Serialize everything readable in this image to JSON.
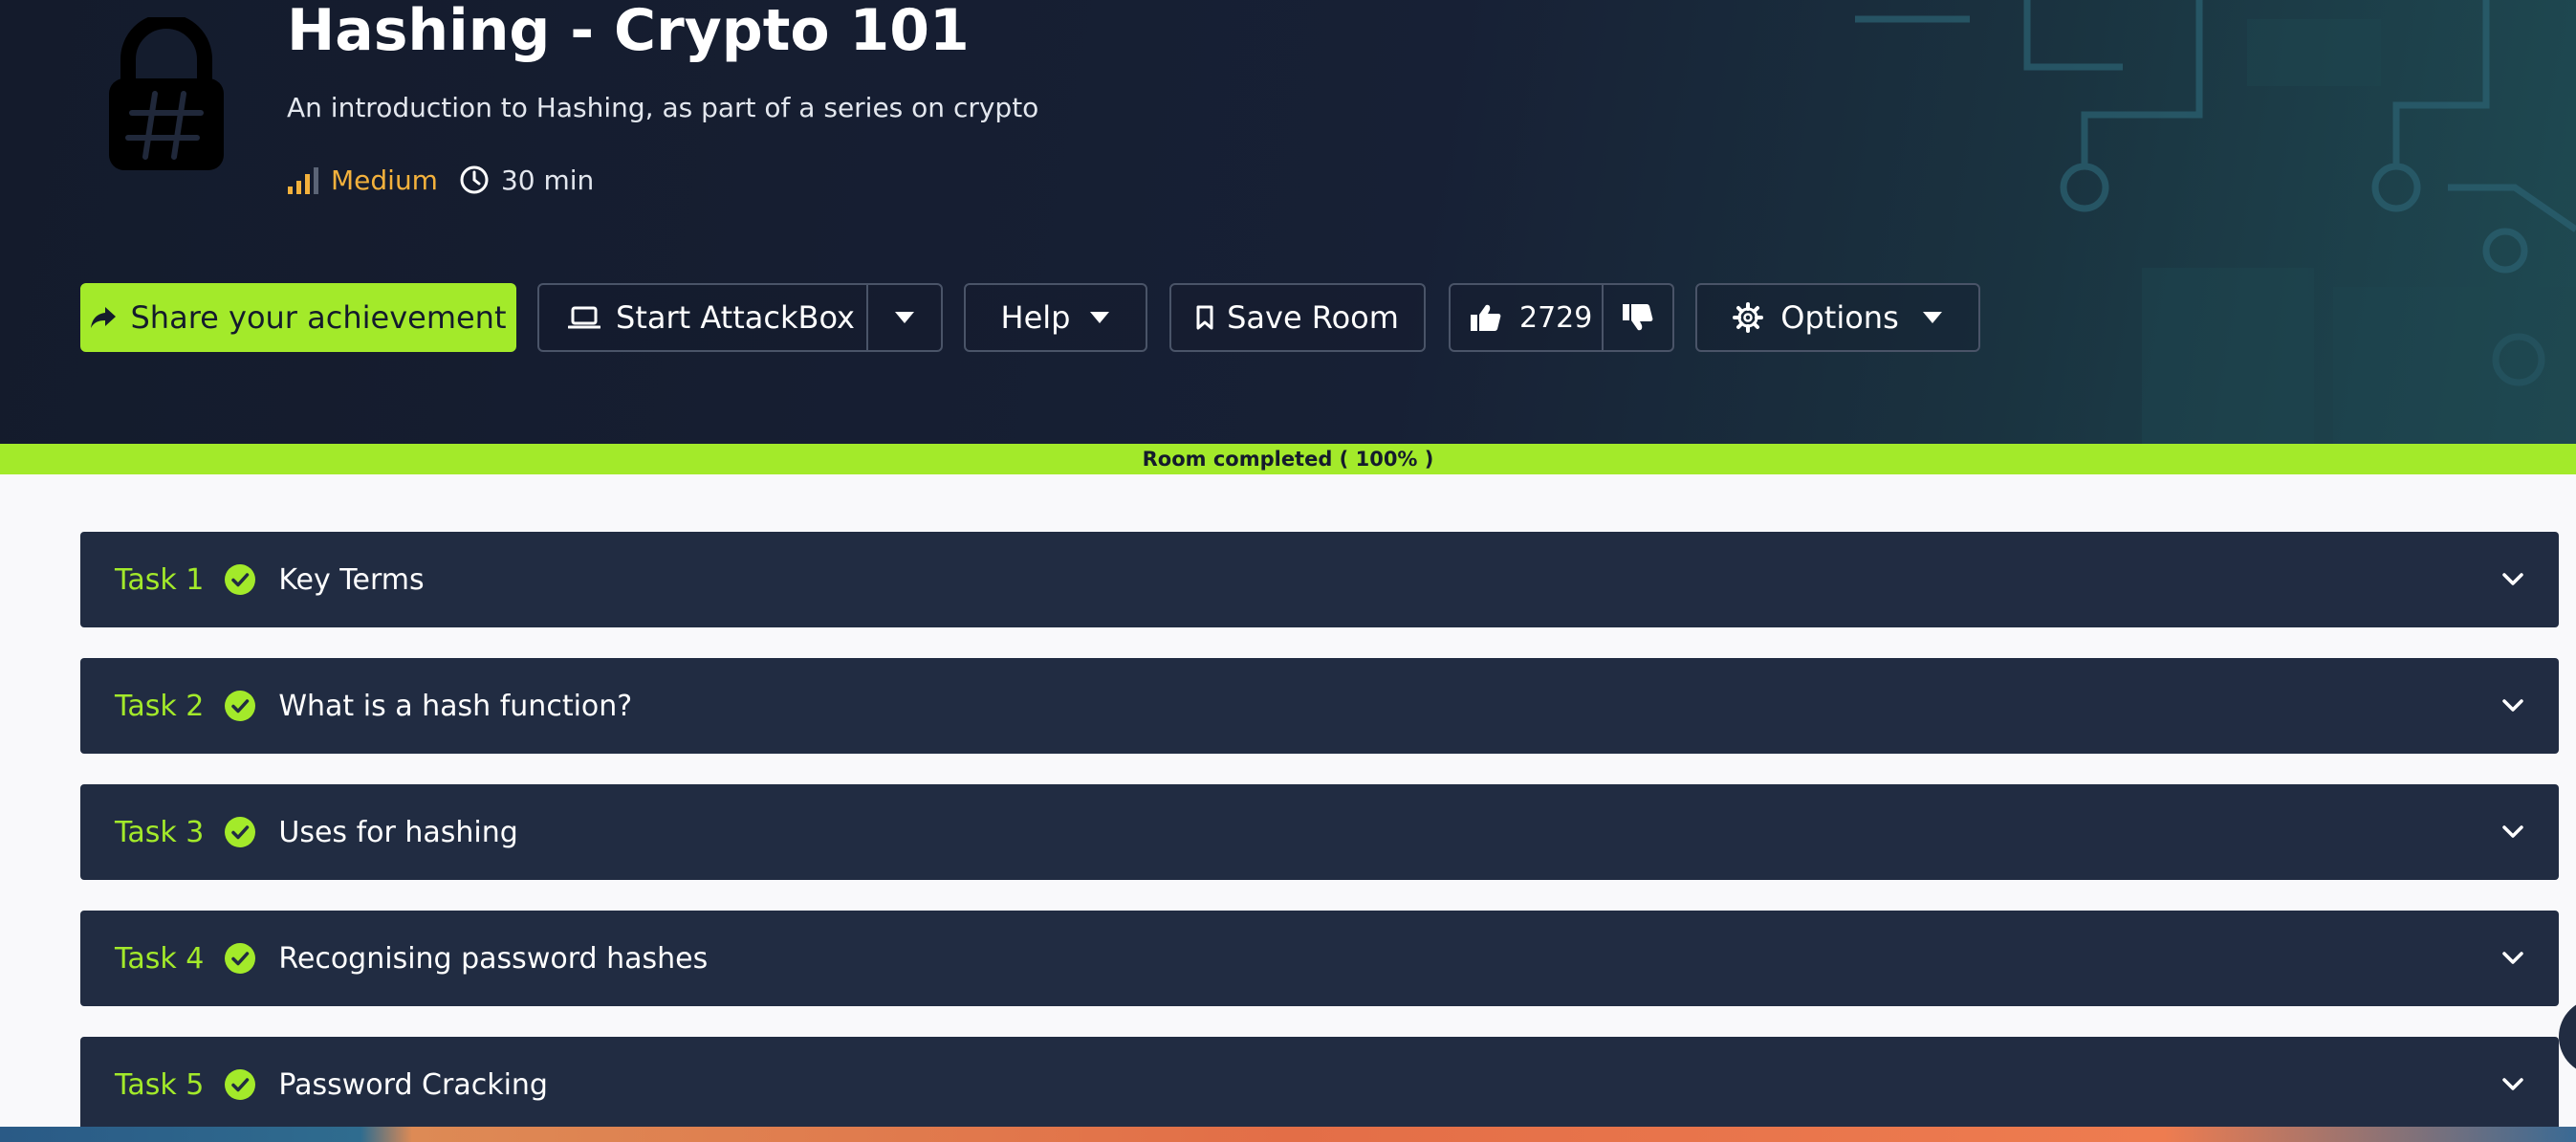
{
  "room": {
    "title": "Hashing - Crypto 101",
    "subtitle": "An introduction to Hashing, as part of a series on crypto",
    "difficulty": "Medium",
    "duration": "30 min",
    "icon": "hash-lock-icon"
  },
  "toolbar": {
    "share_label": "Share your achievement",
    "attackbox_label": "Start AttackBox",
    "help_label": "Help",
    "save_label": "Save Room",
    "likes": "2729",
    "options_label": "Options"
  },
  "progress": {
    "label": "Room completed ( 100% )",
    "percent": 100
  },
  "tasks": [
    {
      "number": "Task 1",
      "title": "Key Terms",
      "completed": true
    },
    {
      "number": "Task 2",
      "title": "What is a hash function?",
      "completed": true
    },
    {
      "number": "Task 3",
      "title": "Uses for hashing",
      "completed": true
    },
    {
      "number": "Task 4",
      "title": "Recognising password hashes",
      "completed": true
    },
    {
      "number": "Task 5",
      "title": "Password Cracking",
      "completed": true
    }
  ],
  "colors": {
    "accent": "#a3ea2a",
    "header_bg": "#141b2c",
    "task_bg": "#212c42",
    "difficulty": "#f3b13c"
  }
}
